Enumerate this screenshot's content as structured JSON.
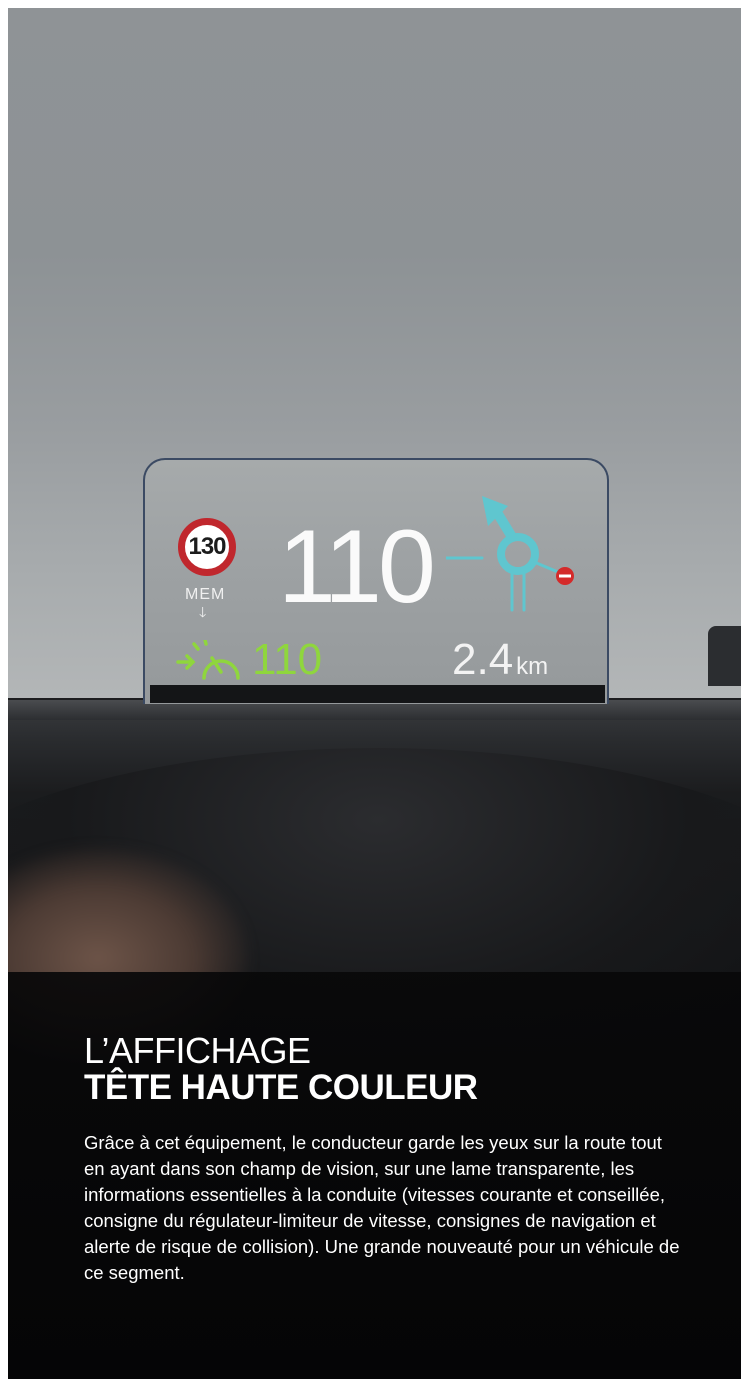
{
  "hud": {
    "speed_limit": "130",
    "mem_label": "MEM",
    "mem_arrow": "🡓",
    "current_speed": "110",
    "cruise_speed": "110",
    "distance_value": "2.4",
    "distance_unit": "km",
    "icons": [
      "speed-limit-sign-icon",
      "roundabout-exit-icon",
      "no-entry-icon",
      "cruise-control-icon"
    ]
  },
  "colors": {
    "speed_limit_ring": "#c0272d",
    "cruise_green": "#8fd63d",
    "nav_cyan": "#5fc6cf",
    "no_entry_red": "#d42a2a"
  },
  "article": {
    "title_line1": "L’AFFICHAGE",
    "title_line2": "TÊTE HAUTE COULEUR",
    "body": "Grâce à cet équipement, le conducteur garde les yeux sur la route tout en ayant dans son champ de vision, sur une lame transparente, les informations essentielles à la conduite (vitesses courante et conseillée, consigne du régulateur-limiteur de vitesse, consignes de navigation et alerte de risque de collision). Une grande nouveauté pour un véhicule de ce segment."
  }
}
